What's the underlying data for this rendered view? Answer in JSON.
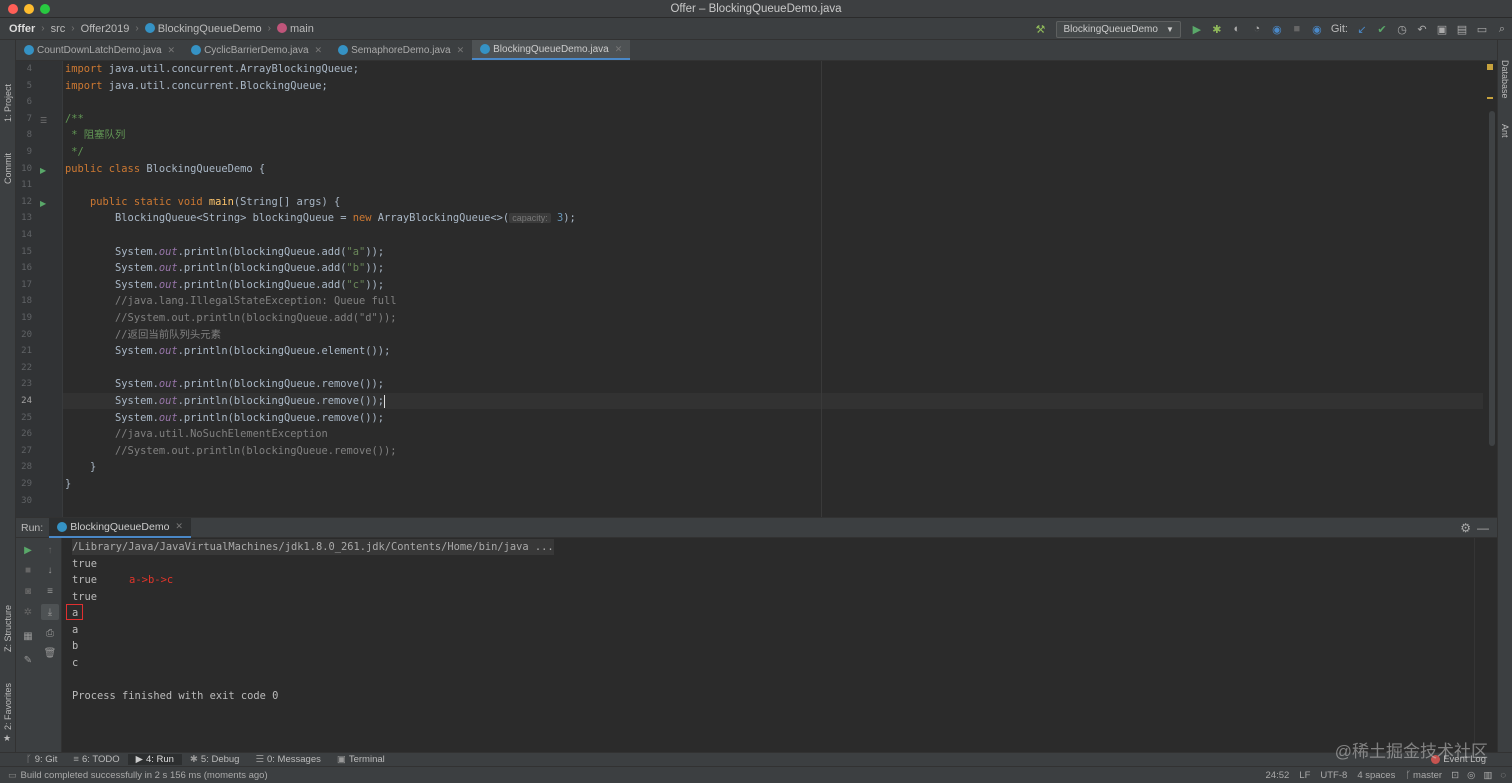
{
  "window": {
    "title": "Offer – BlockingQueueDemo.java"
  },
  "breadcrumb": {
    "project": "Offer",
    "folder1": "src",
    "folder2": "Offer2019",
    "class_name": "BlockingQueueDemo",
    "method": "main"
  },
  "toolbar": {
    "run_config": "BlockingQueueDemo",
    "git_label": "Git:"
  },
  "left_panels": {
    "project": "1: Project",
    "commit": "Commit",
    "structure": "Z: Structure",
    "favorites": "2: Favorites"
  },
  "right_panels": {
    "database": "Database",
    "ant": "Ant"
  },
  "tabs": [
    {
      "label": "CountDownLatchDemo.java"
    },
    {
      "label": "CyclicBarrierDemo.java"
    },
    {
      "label": "SemaphoreDemo.java"
    },
    {
      "label": "BlockingQueueDemo.java"
    }
  ],
  "code": {
    "line_numbers": [
      "4",
      "5",
      "6",
      "7",
      "8",
      "9",
      "10",
      "11",
      "12",
      "13",
      "14",
      "15",
      "16",
      "17",
      "18",
      "19",
      "20",
      "21",
      "22",
      "23",
      "24",
      "25",
      "26",
      "27",
      "28",
      "29",
      "30"
    ],
    "l4_kw": "import",
    "l4_rest": " java.util.concurrent.ArrayBlockingQueue;",
    "l5_kw": "import",
    "l5_rest": " java.util.concurrent.BlockingQueue;",
    "l7": "/**",
    "l8": " * 阻塞队列",
    "l9": " */",
    "l10_kw": "public class",
    "l10_rest": " BlockingQueueDemo {",
    "l12_kw": "    public static void",
    "l12_fn": " main",
    "l12_rest": "(String[] args) {",
    "l13_a": "        BlockingQueue<String> blockingQueue = ",
    "l13_kw": "new",
    "l13_b": " ArrayBlockingQueue<>(",
    "l13_hint": "capacity:",
    "l13_num": " 3",
    "l13_c": ");",
    "l15_a": "        System.",
    "l15_f": "out",
    "l15_b": ".println(blockingQueue.add(",
    "l15_s": "\"a\"",
    "l15_c": "));",
    "l16_a": "        System.",
    "l16_f": "out",
    "l16_b": ".println(blockingQueue.add(",
    "l16_s": "\"b\"",
    "l16_c": "));",
    "l17_a": "        System.",
    "l17_f": "out",
    "l17_b": ".println(blockingQueue.add(",
    "l17_s": "\"c\"",
    "l17_c": "));",
    "l18": "        //java.lang.IllegalStateException: Queue full",
    "l19": "        //System.out.println(blockingQueue.add(\"d\"));",
    "l20": "        //返回当前队列头元素",
    "l21_a": "        System.",
    "l21_f": "out",
    "l21_b": ".println(blockingQueue.element());",
    "l23_a": "        System.",
    "l23_f": "out",
    "l23_b": ".println(blockingQueue.remove());",
    "l24_a": "        System.",
    "l24_f": "out",
    "l24_b": ".println(blockingQueue.remove());",
    "l25_a": "        System.",
    "l25_f": "out",
    "l25_b": ".println(blockingQueue.remove());",
    "l26": "        //java.util.NoSuchElementException",
    "l27": "        //System.out.println(blockingQueue.remove());",
    "l28": "    }",
    "l29": "}"
  },
  "run": {
    "label": "Run:",
    "tab": "BlockingQueueDemo",
    "output": [
      "/Library/Java/JavaVirtualMachines/jdk1.8.0_261.jdk/Contents/Home/bin/java ...",
      "true",
      "true",
      "true",
      "a",
      "a",
      "b",
      "c",
      "",
      "Process finished with exit code 0"
    ],
    "annotation": "a->b->c"
  },
  "bottom_tools": [
    {
      "label": "9: Git"
    },
    {
      "label": "6: TODO"
    },
    {
      "label": "4: Run"
    },
    {
      "label": "5: Debug"
    },
    {
      "label": "0: Messages"
    },
    {
      "label": "Terminal"
    }
  ],
  "event_log": "Event Log",
  "status": {
    "message": "Build completed successfully in 2 s 156 ms (moments ago)",
    "position": "24:52",
    "line_sep": "LF",
    "encoding": "UTF-8",
    "indent": "4 spaces",
    "branch": "master"
  },
  "watermark": "@稀土掘金技术社区",
  "colors": {
    "accent": "#4a88c7",
    "keyword": "#cc7832",
    "string": "#6a8759",
    "annotation_red": "#e0352b"
  }
}
